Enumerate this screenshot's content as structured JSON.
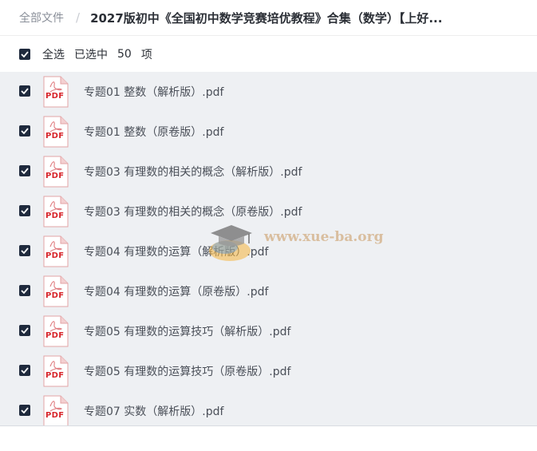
{
  "breadcrumb": {
    "root": "全部文件",
    "separator": "/",
    "current": "2027版初中《全国初中数学竞赛培优教程》合集（数学）【上好..."
  },
  "selection": {
    "all_label": "全选",
    "selected_label": "已选中",
    "count": "50",
    "unit": "项"
  },
  "icons": {
    "checkbox": "checkbox-checked-icon",
    "file": "pdf-file-icon",
    "pdf_text": "PDF"
  },
  "files": [
    {
      "name": "专题01 整数（解析版）.pdf"
    },
    {
      "name": "专题01 整数（原卷版）.pdf"
    },
    {
      "name": "专题03 有理数的相关的概念（解析版）.pdf"
    },
    {
      "name": "专题03 有理数的相关的概念（原卷版）.pdf"
    },
    {
      "name": "专题04 有理数的运算（解析版）.pdf"
    },
    {
      "name": "专题04 有理数的运算（原卷版）.pdf"
    },
    {
      "name": "专题05 有理数的运算技巧（解析版）.pdf"
    },
    {
      "name": "专题05 有理数的运算技巧（原卷版）.pdf"
    },
    {
      "name": "专题07 实数（解析版）.pdf"
    }
  ],
  "watermark": {
    "text": "www.xue-ba.org"
  },
  "colors": {
    "checkbox": "#1f2a3d",
    "list_background": "#eef0f3",
    "pdf_red": "#d8252b"
  }
}
